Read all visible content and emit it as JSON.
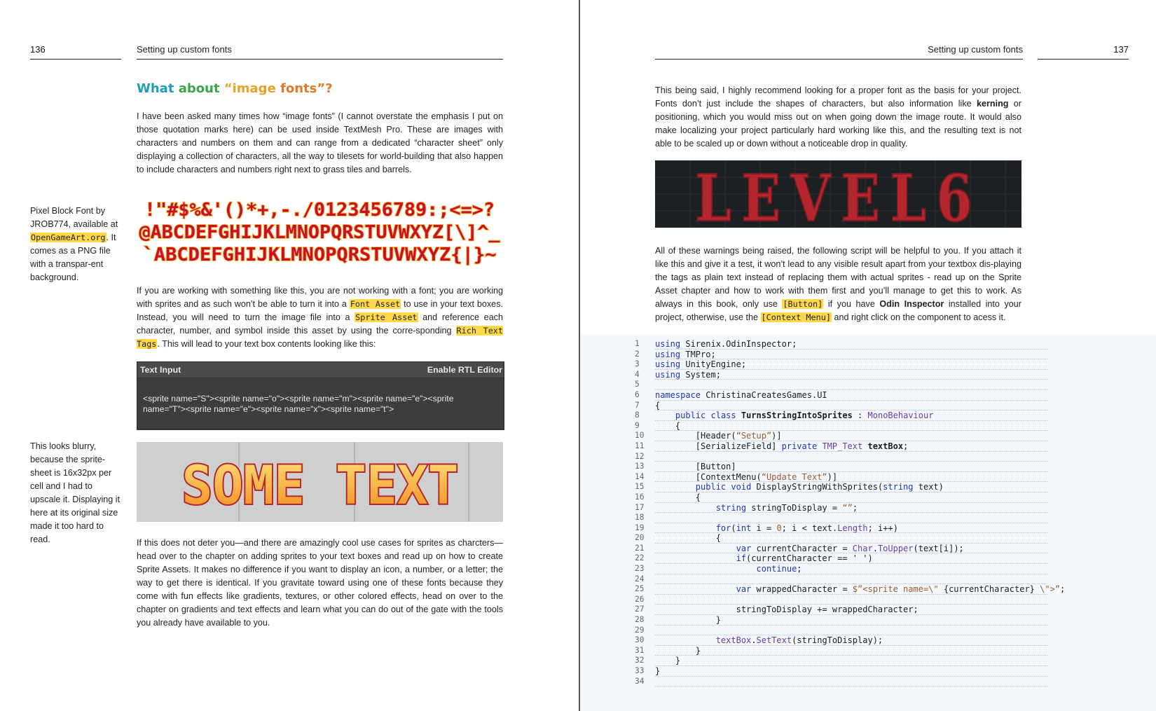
{
  "left": {
    "page_number": "136",
    "header": "Setting up custom fonts",
    "heading": {
      "p1": "What ",
      "p2": "about ",
      "p3": "“image ",
      "p4": "fonts”?"
    },
    "intro": "I have been asked many times how “image fonts” (I cannot overstate the emphasis I put on those quotation marks here) can be used inside TextMesh Pro. These are images with characters and numbers on them and can range from a dedicated “character sheet” only displaying a collection of characters, all the way to tilesets for world-building that also happen to include characters and numbers right next to grass tiles and barrels.",
    "sidenote1": {
      "a": "Pixel Block Font by JROB774, available at ",
      "link": "OpenGameArt.org",
      "b": ". It comes as a PNG file with a transpar-ent background."
    },
    "pixel_font_rows": [
      "!\"#$%&'()*+,-./0123456789:;<=>?",
      "@ABCDEFGHIJKLMNOPQRSTUVWXYZ[\\]^_",
      "`ABCDEFGHIJKLMNOPQRSTUVWXYZ{|}~"
    ],
    "para2": {
      "a": "If you are working with something like this, you are not working with a font; you are working with sprites and as such won’t be able to turn it into a ",
      "t1": "Font Asset",
      "b": " to use in your text boxes. Instead, you will need to turn the image file into a ",
      "t2": "Sprite Asset",
      "c": " and reference each character, number, and symbol inside this asset by using the corre-sponding ",
      "t3": "Rich Text Tags",
      "d": ". This will lead to your text box contents looking like this:"
    },
    "text_input_panel": {
      "title": "Text Input",
      "right_label": "Enable RTL Editor",
      "content_line1": "<sprite name=\"S\"><sprite name=\"o\"><sprite name=\"m\"><sprite name=\"e\"><sprite",
      "content_line2": "name=\"T\"><sprite name=\"e\"><sprite name=\"x\"><sprite name=\"t\">"
    },
    "sidenote2": "This looks blurry, because the sprite-sheet is 16x32px per cell and I had to upscale it. Displaying it here at its original size made it too hard to read.",
    "some_text_image": "SOME TEXT",
    "para3": "If this does not deter you—and there are amazingly cool use cases for sprites as charcters—head over to the chapter on adding sprites to your text boxes and read up on how to create Sprite Assets. It makes no difference if you want to display an icon, a number, or a letter; the way to get there is identical. If you gravitate toward using one of these fonts because they come with fun effects like gradients, textures, or other colored effects, head on over to the chapter on gradients and text effects and learn what you can do out of the gate with the tools you already have available to you."
  },
  "right": {
    "page_number": "137",
    "header": "Setting up custom fonts",
    "para1": {
      "a": "This being said, I highly recommend looking for a proper font as the basis for your project. Fonts don’t just include the shapes of characters, but also information like ",
      "bold": "kerning",
      "b": " or positioning, which you would miss out on when going down the image route. It would also make localizing your project particularly hard working like this, and the resulting text is not able to be scaled up or down without a noticeable drop in quality."
    },
    "level_image": "LEVEL6",
    "para2": {
      "a": "All of these warnings being raised, the following script will be helpful to you. If you attach it like this and give it a test, it won’t lead to any visible result apart from your textbox dis-playing the tags as plain text instead of replacing them with actual sprites - read up on the Sprite Asset chapter and how to work with them first and you’ll manage to get this to work. As always in this book, only use ",
      "t1": "[Button]",
      "b": " if you have ",
      "bold": "Odin Inspector",
      "c": " installed into your project, otherwise, use the ",
      "t2": "[Context Menu]",
      "d": " and right click on the component to acess it."
    },
    "code": [
      {
        "n": "1",
        "s": [
          [
            "k",
            "using"
          ],
          [
            "",
            "Sirenix.OdinInspector;"
          ]
        ]
      },
      {
        "n": "2",
        "s": [
          [
            "k",
            "using"
          ],
          [
            "",
            "TMPro;"
          ]
        ]
      },
      {
        "n": "3",
        "s": [
          [
            "k",
            "using"
          ],
          [
            "",
            "UnityEngine;"
          ]
        ]
      },
      {
        "n": "4",
        "s": [
          [
            "k",
            "using"
          ],
          [
            "",
            "System;"
          ]
        ]
      },
      {
        "n": "5",
        "s": []
      },
      {
        "n": "6",
        "s": [
          [
            "k",
            "namespace"
          ],
          [
            "",
            "ChristinaCreatesGames.UI"
          ]
        ]
      },
      {
        "n": "7",
        "s": [
          [
            "",
            "{"
          ]
        ]
      },
      {
        "n": "8",
        "s": [
          [
            "",
            "    "
          ],
          [
            "k",
            "public"
          ],
          [
            "k",
            "class"
          ],
          [
            "b",
            "TurnsStringIntoSprites"
          ],
          [
            "",
            ":"
          ],
          [
            "t",
            "MonoBehaviour"
          ]
        ]
      },
      {
        "n": "9",
        "s": [
          [
            "",
            "    {"
          ]
        ]
      },
      {
        "n": "10",
        "s": [
          [
            "",
            "        [Header("
          ],
          [
            "s",
            "“Setup”"
          ],
          [
            "",
            ")]"
          ]
        ]
      },
      {
        "n": "11",
        "s": [
          [
            "",
            "        [SerializeField]"
          ],
          [
            "k",
            "private"
          ],
          [
            "t",
            "TMP_Text"
          ],
          [
            "b",
            "textBox"
          ],
          [
            "",
            ";"
          ]
        ]
      },
      {
        "n": "12",
        "s": []
      },
      {
        "n": "13",
        "s": [
          [
            "",
            "        [Button]"
          ]
        ]
      },
      {
        "n": "14",
        "s": [
          [
            "",
            "        [ContextMenu("
          ],
          [
            "s",
            "“Update Text”"
          ],
          [
            "",
            ")]"
          ]
        ]
      },
      {
        "n": "15",
        "s": [
          [
            "",
            "        "
          ],
          [
            "k",
            "public"
          ],
          [
            "k",
            "void"
          ],
          [
            "",
            "DisplayStringWithSprites("
          ],
          [
            "k",
            "string"
          ],
          [
            "",
            "text)"
          ]
        ]
      },
      {
        "n": "16",
        "s": [
          [
            "",
            "        {"
          ]
        ]
      },
      {
        "n": "17",
        "s": [
          [
            "",
            "            "
          ],
          [
            "k",
            "string"
          ],
          [
            "",
            "stringToDisplay ="
          ],
          [
            "s",
            "“”"
          ],
          [
            "",
            ";"
          ]
        ]
      },
      {
        "n": "18",
        "s": []
      },
      {
        "n": "19",
        "s": [
          [
            "",
            "            "
          ],
          [
            "k",
            "for"
          ],
          [
            "",
            "("
          ],
          [
            "k",
            "int"
          ],
          [
            "",
            "i ="
          ],
          [
            "s",
            "0"
          ],
          [
            "",
            ";"
          ],
          [
            "",
            "i < text."
          ],
          [
            "t",
            "Length"
          ],
          [
            "",
            ";"
          ],
          [
            "",
            "i++)"
          ]
        ]
      },
      {
        "n": "20",
        "s": [
          [
            "",
            "            {"
          ]
        ]
      },
      {
        "n": "21",
        "s": [
          [
            "",
            "                "
          ],
          [
            "k",
            "var"
          ],
          [
            "",
            "currentCharacter ="
          ],
          [
            "t",
            "Char"
          ],
          [
            "",
            "."
          ],
          [
            "t",
            "ToUpper"
          ],
          [
            "",
            "(text[i]);"
          ]
        ]
      },
      {
        "n": "22",
        "s": [
          [
            "",
            "                "
          ],
          [
            "k",
            "if"
          ],
          [
            "",
            "(currentCharacter == ' ')"
          ]
        ]
      },
      {
        "n": "23",
        "s": [
          [
            "",
            "                    "
          ],
          [
            "k",
            "continue"
          ],
          [
            "",
            ";"
          ]
        ]
      },
      {
        "n": "24",
        "s": []
      },
      {
        "n": "25",
        "s": [
          [
            "",
            "                "
          ],
          [
            "k",
            "var"
          ],
          [
            "",
            "wrappedCharacter ="
          ],
          [
            "s",
            "$”<sprite name=\\\""
          ],
          [
            "",
            "{currentCharacter}"
          ],
          [
            "s",
            "\\\">”"
          ],
          [
            "",
            ";"
          ]
        ]
      },
      {
        "n": "26",
        "s": []
      },
      {
        "n": "27",
        "s": [
          [
            "",
            "                stringToDisplay += wrappedCharacter;"
          ]
        ]
      },
      {
        "n": "28",
        "s": [
          [
            "",
            "            }"
          ]
        ]
      },
      {
        "n": "29",
        "s": []
      },
      {
        "n": "30",
        "s": [
          [
            "",
            "            "
          ],
          [
            "t",
            "textBox"
          ],
          [
            "",
            "."
          ],
          [
            "t",
            "SetText"
          ],
          [
            "",
            "(stringToDisplay);"
          ]
        ]
      },
      {
        "n": "31",
        "s": [
          [
            "",
            "        }"
          ]
        ]
      },
      {
        "n": "32",
        "s": [
          [
            "",
            "    }"
          ]
        ]
      },
      {
        "n": "33",
        "s": [
          [
            "",
            "}"
          ]
        ]
      },
      {
        "n": "34",
        "s": []
      }
    ]
  },
  "colors": {
    "heading_1": "#1f9bbf",
    "heading_2": "#3aa64a",
    "heading_3": "#e8a32a",
    "heading_4": "#e07a2a",
    "highlight": "#ffd84a",
    "pixel_font_red": "#c8102e",
    "pixel_font_gold": "#f5c542",
    "level_red": "#b3262e"
  }
}
